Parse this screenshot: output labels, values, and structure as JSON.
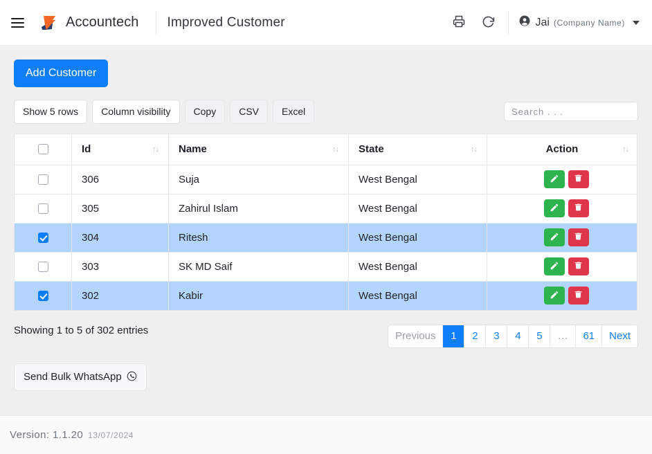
{
  "navbar": {
    "menu_icon": "hamburger-menu-icon",
    "brand": "Accountech",
    "page_title": "Improved Customer",
    "print_icon": "printer-icon",
    "refresh_icon": "refresh-icon",
    "user_icon": "user-circle-icon",
    "user_name": "Jai",
    "company_name": "(Company Name)",
    "caret_icon": "chevron-down-icon"
  },
  "toolbar": {
    "add_customer_label": "Add Customer",
    "show_rows_label": "Show 5 rows",
    "column_visibility_label": "Column visibility",
    "copy_label": "Copy",
    "csv_label": "CSV",
    "excel_label": "Excel",
    "search_placeholder": "Search . . ."
  },
  "table": {
    "sort_icon": "sort-updown-icon",
    "columns": [
      {
        "key": "check",
        "label": ""
      },
      {
        "key": "id",
        "label": "Id"
      },
      {
        "key": "name",
        "label": "Name"
      },
      {
        "key": "state",
        "label": "State"
      },
      {
        "key": "action",
        "label": "Action"
      }
    ],
    "header_select_all_checked": false,
    "rows": [
      {
        "selected": false,
        "id": "306",
        "name": "Suja",
        "state": "West Bengal"
      },
      {
        "selected": false,
        "id": "305",
        "name": "Zahirul Islam",
        "state": "West Bengal"
      },
      {
        "selected": true,
        "id": "304",
        "name": "Ritesh",
        "state": "West Bengal"
      },
      {
        "selected": false,
        "id": "303",
        "name": "SK MD Saif",
        "state": "West Bengal"
      },
      {
        "selected": true,
        "id": "302",
        "name": "Kabir",
        "state": "West Bengal"
      }
    ],
    "edit_icon": "pencil-edit-icon",
    "delete_icon": "trash-delete-icon"
  },
  "footer_bar": {
    "entries_info": "Showing 1 to 5 of 302 entries",
    "pagination": [
      {
        "label": "Previous",
        "state": "disabled"
      },
      {
        "label": "1",
        "state": "active"
      },
      {
        "label": "2",
        "state": "normal"
      },
      {
        "label": "3",
        "state": "normal"
      },
      {
        "label": "4",
        "state": "normal"
      },
      {
        "label": "5",
        "state": "normal"
      },
      {
        "label": "…",
        "state": "dots"
      },
      {
        "label": "61",
        "state": "normal"
      },
      {
        "label": "Next",
        "state": "normal"
      }
    ],
    "whatsapp_label": "Send Bulk WhatsApp",
    "whatsapp_icon": "whatsapp-icon"
  },
  "page_footer": {
    "version": "Version: 1.1.20",
    "date": "13/07/2024"
  },
  "colors": {
    "primary": "#0d7ef7",
    "selected_row": "#b3d4fc",
    "edit_green": "#2eb44e",
    "delete_red": "#e0364c",
    "page_bg": "#f0f0f0"
  }
}
